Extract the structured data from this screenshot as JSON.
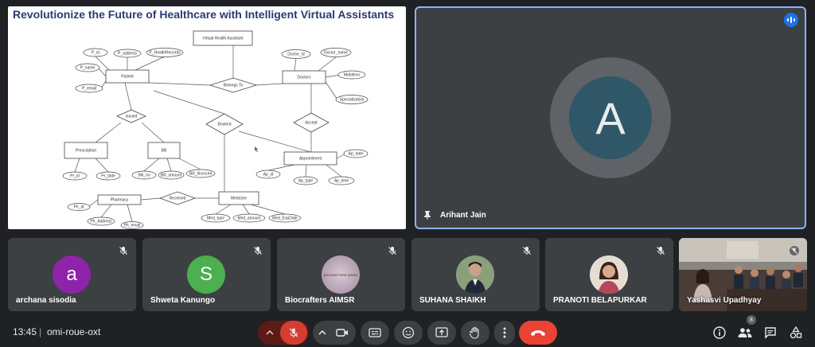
{
  "presentation": {
    "slide_title": "Revolutionize the Future of Healthcare with Intelligent Virtual Assistants",
    "er": {
      "entities": [
        "Virtual Health Assistant",
        "Patient",
        "Doctors",
        "Prescription",
        "Bill",
        "Appointment",
        "Pharmacy",
        "Medicine"
      ],
      "relationships": [
        "Belongs To",
        "Issued",
        "Booked",
        "Accept",
        "Received"
      ],
      "attributes": [
        "P_id",
        "P_address",
        "P_HealthRecords",
        "P_name",
        "P_email",
        "Doctor_id",
        "Doctor_name",
        "Mobileno",
        "Specialization",
        "Pr_id",
        "Pr_date",
        "Bill_no",
        "Bill_amount",
        "Bill_discount",
        "Ap_date",
        "Ap_id",
        "Ap_type",
        "Ap_time",
        "Ph_id",
        "Ph_Address",
        "Ph_email",
        "Med_type",
        "Med_amount",
        "Med_ExpDate"
      ]
    }
  },
  "speaker": {
    "initial": "A",
    "name": "Arihant Jain",
    "avatar_color": "#2f5767"
  },
  "participants": [
    {
      "name": "archana sisodia",
      "initial": "a",
      "color": "#8e24aa"
    },
    {
      "name": "Shweta Kanungo",
      "initial": "S",
      "color": "#4caf50"
    },
    {
      "name": "Biocrafters AIMSR",
      "initial": "BIOCRAFTERS AIMSR",
      "color": "#c9b8c8"
    },
    {
      "name": "SUHANA SHAIKH",
      "initial": "",
      "color": "#6b7a5a"
    },
    {
      "name": "PRANOTI BELAPURKAR",
      "initial": "",
      "color": "#8a6a5c"
    },
    {
      "name": "Yashasvi Upadhyay",
      "initial": "",
      "color": "#555"
    }
  ],
  "bottom_bar": {
    "time": "13:45",
    "separator": "|",
    "meeting_code": "omi-roue-oxt",
    "participant_count": "8",
    "colors": {
      "danger": "#ea4335",
      "mic_off_bg": "#5c1c16",
      "control_bg": "#3c4043"
    }
  }
}
